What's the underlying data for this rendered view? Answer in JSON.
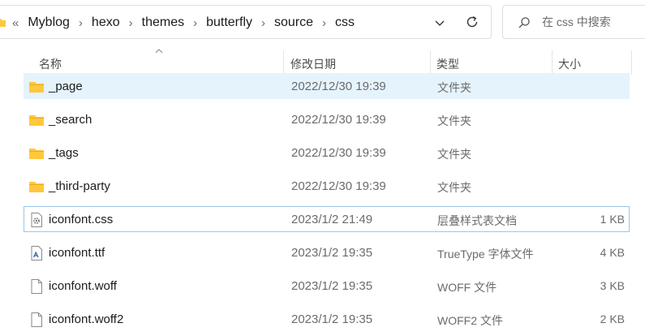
{
  "address_bar": {
    "prefix": "«",
    "path": [
      "Myblog",
      "hexo",
      "themes",
      "butterfly",
      "source",
      "css"
    ]
  },
  "search": {
    "placeholder": "在 css 中搜索"
  },
  "columns": {
    "name": "名称",
    "modified": "修改日期",
    "type": "类型",
    "size": "大小"
  },
  "files": [
    {
      "name": "_page",
      "modified": "2022/12/30 19:39",
      "type": "文件夹",
      "size": "",
      "icon": "folder-icon",
      "state": "selected"
    },
    {
      "name": "_search",
      "modified": "2022/12/30 19:39",
      "type": "文件夹",
      "size": "",
      "icon": "folder-icon",
      "state": ""
    },
    {
      "name": "_tags",
      "modified": "2022/12/30 19:39",
      "type": "文件夹",
      "size": "",
      "icon": "folder-icon",
      "state": ""
    },
    {
      "name": "_third-party",
      "modified": "2022/12/30 19:39",
      "type": "文件夹",
      "size": "",
      "icon": "folder-icon",
      "state": ""
    },
    {
      "name": "iconfont.css",
      "modified": "2023/1/2 21:49",
      "type": "层叠样式表文档",
      "size": "1 KB",
      "icon": "css-file-icon",
      "state": "focused"
    },
    {
      "name": "iconfont.ttf",
      "modified": "2023/1/2 19:35",
      "type": "TrueType 字体文件",
      "size": "4 KB",
      "icon": "font-file-icon",
      "state": ""
    },
    {
      "name": "iconfont.woff",
      "modified": "2023/1/2 19:35",
      "type": "WOFF 文件",
      "size": "3 KB",
      "icon": "file-icon",
      "state": ""
    },
    {
      "name": "iconfont.woff2",
      "modified": "2023/1/2 19:35",
      "type": "WOFF2 文件",
      "size": "2 KB",
      "icon": "file-icon",
      "state": ""
    }
  ],
  "colors": {
    "selection": "#e5f3fd",
    "focus_border": "#99c7ec",
    "folder": "#ffc83d",
    "secondary_text": "#6b6b6b"
  }
}
